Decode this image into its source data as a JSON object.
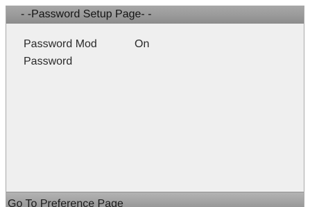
{
  "page": {
    "title": "- -Password Setup Page- -"
  },
  "settings": [
    {
      "label": "Password Mod",
      "value": "On"
    },
    {
      "label": "Password",
      "value": ""
    }
  ],
  "footer": {
    "hint": "Go To Preference Page"
  },
  "colors": {
    "panel_background": "#efefef",
    "title_bar": "#9a9a9a",
    "footer_bar": "#a3a3a3",
    "text": "#2a2a2a"
  }
}
